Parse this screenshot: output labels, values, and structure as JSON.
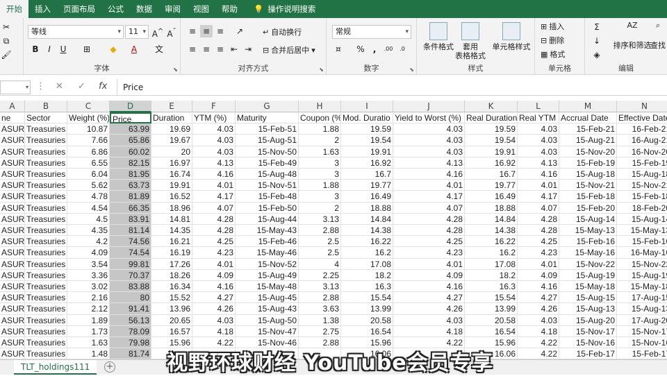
{
  "tabs": [
    "开始",
    "插入",
    "页面布局",
    "公式",
    "数据",
    "审阅",
    "视图",
    "帮助"
  ],
  "tell_me": "操作说明搜索",
  "ribbon": {
    "clipboard_label": "",
    "font_name": "等线",
    "font_size": "11",
    "font_group_label": "字体",
    "align_group_label": "对齐方式",
    "wrap_text": "自动换行",
    "merge_center": "合并后居中",
    "number_format": "常规",
    "number_group_label": "数字",
    "cond_format": "条件格式",
    "format_table_1": "套用",
    "format_table_2": "表格格式",
    "cell_style": "单元格样式",
    "styles_group_label": "样式",
    "insert": "插入",
    "delete": "删除",
    "format": "格式",
    "cells_group_label": "单元格",
    "sort_filter": "排序和筛选",
    "find_select": "查找",
    "editing_group_label": "编辑"
  },
  "formula_bar": {
    "name_box": "",
    "value": "Price"
  },
  "columns": [
    "A",
    "B",
    "C",
    "D",
    "E",
    "F",
    "G",
    "H",
    "I",
    "J",
    "K",
    "L",
    "M",
    "N"
  ],
  "headers": [
    "ne",
    "Sector",
    "Weight (%)",
    "Price",
    "Duration",
    "YTM (%)",
    "Maturity",
    "Coupon (%",
    "Mod. Duratio",
    "Yield to Worst (%)",
    "Real Duration",
    "Real YTM (",
    "Accrual Date",
    "Effective Date"
  ],
  "rows": [
    [
      "ASURY",
      "Treasuries",
      "10.87",
      "63.99",
      "19.69",
      "4.03",
      "15-Feb-51",
      "1.88",
      "19.59",
      "4.03",
      "19.59",
      "4.03",
      "15-Feb-21",
      "16-Feb-21"
    ],
    [
      "ASURY",
      "Treasuries",
      "7.66",
      "65.86",
      "19.67",
      "4.03",
      "15-Aug-51",
      "2",
      "19.54",
      "4.03",
      "19.54",
      "4.03",
      "15-Aug-21",
      "16-Aug-21"
    ],
    [
      "ASURY",
      "Treasuries",
      "6.86",
      "60.02",
      "20",
      "4.03",
      "15-Nov-50",
      "1.63",
      "19.91",
      "4.03",
      "19.91",
      "4.03",
      "15-Nov-20",
      "16-Nov-20"
    ],
    [
      "ASURY",
      "Treasuries",
      "6.55",
      "82.15",
      "16.97",
      "4.13",
      "15-Feb-49",
      "3",
      "16.92",
      "4.13",
      "16.92",
      "4.13",
      "15-Feb-19",
      "15-Feb-19"
    ],
    [
      "ASURY",
      "Treasuries",
      "6.04",
      "81.95",
      "16.74",
      "4.16",
      "15-Aug-48",
      "3",
      "16.7",
      "4.16",
      "16.7",
      "4.16",
      "15-Aug-18",
      "15-Aug-18"
    ],
    [
      "ASURY",
      "Treasuries",
      "5.62",
      "63.73",
      "19.91",
      "4.01",
      "15-Nov-51",
      "1.88",
      "19.77",
      "4.01",
      "19.77",
      "4.01",
      "15-Nov-21",
      "15-Nov-21"
    ],
    [
      "ASURY",
      "Treasuries",
      "4.78",
      "81.89",
      "16.52",
      "4.17",
      "15-Feb-48",
      "3",
      "16.49",
      "4.17",
      "16.49",
      "4.17",
      "15-Feb-18",
      "15-Feb-18"
    ],
    [
      "ASURY",
      "Treasuries",
      "4.54",
      "66.35",
      "18.96",
      "4.07",
      "15-Feb-50",
      "2",
      "18.88",
      "4.07",
      "18.88",
      "4.07",
      "15-Feb-20",
      "18-Feb-20"
    ],
    [
      "ASURY",
      "Treasuries",
      "4.5",
      "83.91",
      "14.81",
      "4.28",
      "15-Aug-44",
      "3.13",
      "14.84",
      "4.28",
      "14.84",
      "4.28",
      "15-Aug-14",
      "15-Aug-14"
    ],
    [
      "ASURY",
      "Treasuries",
      "4.35",
      "81.14",
      "14.35",
      "4.28",
      "15-May-43",
      "2.88",
      "14.38",
      "4.28",
      "14.38",
      "4.28",
      "15-May-13",
      "15-May-13"
    ],
    [
      "ASURY",
      "Treasuries",
      "4.2",
      "74.56",
      "16.21",
      "4.25",
      "15-Feb-46",
      "2.5",
      "16.22",
      "4.25",
      "16.22",
      "4.25",
      "15-Feb-16",
      "15-Feb-16"
    ],
    [
      "ASURY",
      "Treasuries",
      "4.09",
      "74.54",
      "16.19",
      "4.23",
      "15-May-46",
      "2.5",
      "16.2",
      "4.23",
      "16.2",
      "4.23",
      "15-May-16",
      "16-May-16"
    ],
    [
      "ASURY",
      "Treasuries",
      "3.54",
      "99.81",
      "17.26",
      "4.01",
      "15-Nov-52",
      "4",
      "17.08",
      "4.01",
      "17.08",
      "4.01",
      "15-Nov-22",
      "15-Nov-22"
    ],
    [
      "ASURY",
      "Treasuries",
      "3.36",
      "70.37",
      "18.26",
      "4.09",
      "15-Aug-49",
      "2.25",
      "18.2",
      "4.09",
      "18.2",
      "4.09",
      "15-Aug-19",
      "15-Aug-19"
    ],
    [
      "ASURY",
      "Treasuries",
      "3.02",
      "83.88",
      "16.34",
      "4.16",
      "15-May-48",
      "3.13",
      "16.3",
      "4.16",
      "16.3",
      "4.16",
      "15-May-18",
      "15-May-18"
    ],
    [
      "ASURY",
      "Treasuries",
      "2.16",
      "80",
      "15.52",
      "4.27",
      "15-Aug-45",
      "2.88",
      "15.54",
      "4.27",
      "15.54",
      "4.27",
      "15-Aug-15",
      "17-Aug-15"
    ],
    [
      "ASURY",
      "Treasuries",
      "2.12",
      "91.41",
      "13.96",
      "4.26",
      "15-Aug-43",
      "3.63",
      "13.99",
      "4.26",
      "13.99",
      "4.26",
      "15-Aug-13",
      "15-Aug-13"
    ],
    [
      "ASURY",
      "Treasuries",
      "1.89",
      "56.13",
      "20.65",
      "4.03",
      "15-Aug-50",
      "1.38",
      "20.58",
      "4.03",
      "20.58",
      "4.03",
      "15-Aug-20",
      "17-Aug-20"
    ],
    [
      "ASURY",
      "Treasuries",
      "1.73",
      "78.09",
      "16.57",
      "4.18",
      "15-Nov-47",
      "2.75",
      "16.54",
      "4.18",
      "16.54",
      "4.18",
      "15-Nov-17",
      "15-Nov-17"
    ],
    [
      "ASURY",
      "Treasuries",
      "1.63",
      "79.98",
      "15.96",
      "4.22",
      "15-Nov-46",
      "2.88",
      "15.96",
      "4.22",
      "15.96",
      "4.22",
      "15-Nov-16",
      "15-Nov-16"
    ],
    [
      "ASURY",
      "Treasuries",
      "1.48",
      "81.74",
      "",
      "",
      "",
      "",
      "16.06",
      "",
      "16.06",
      "4.22",
      "15-Feb-17",
      "15-Feb-17"
    ]
  ],
  "sheet_tab": "TLT_holdings111",
  "subtitle": "视野环球财经 YouTube会员专享",
  "colors": {
    "accent": "#217346",
    "selected_column": "#c6c6c6"
  }
}
